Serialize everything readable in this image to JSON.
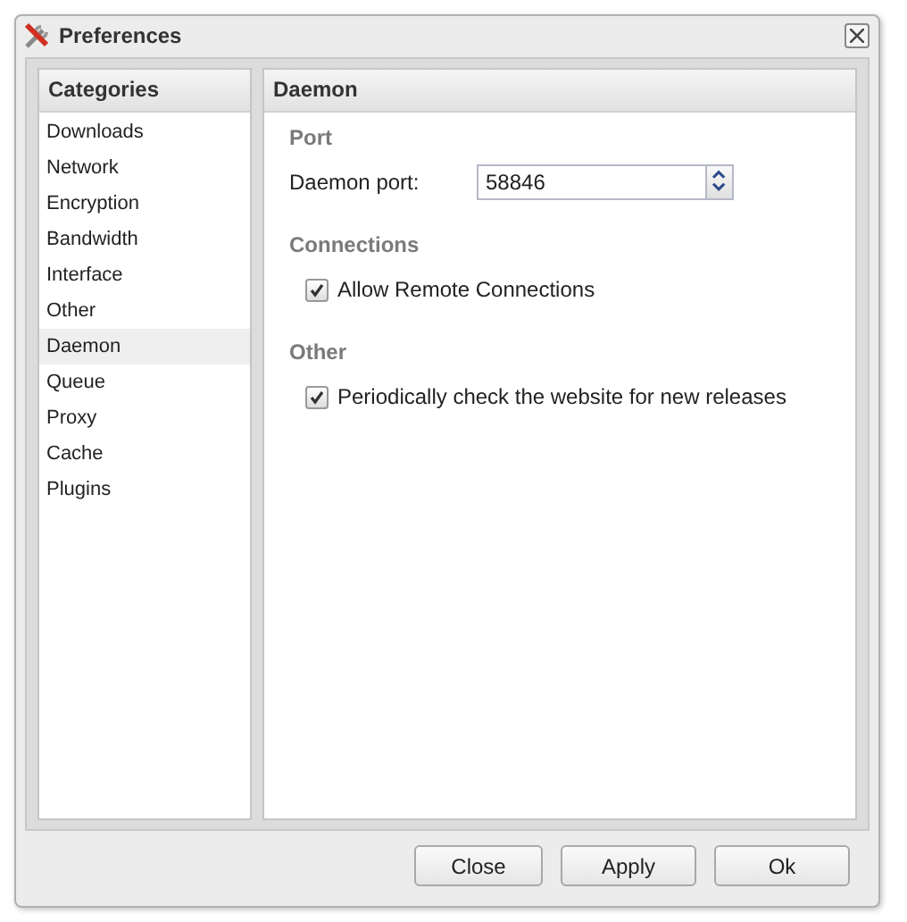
{
  "window": {
    "title": "Preferences"
  },
  "categories": {
    "title": "Categories",
    "items": [
      {
        "label": "Downloads",
        "selected": false
      },
      {
        "label": "Network",
        "selected": false
      },
      {
        "label": "Encryption",
        "selected": false
      },
      {
        "label": "Bandwidth",
        "selected": false
      },
      {
        "label": "Interface",
        "selected": false
      },
      {
        "label": "Other",
        "selected": false
      },
      {
        "label": "Daemon",
        "selected": true
      },
      {
        "label": "Queue",
        "selected": false
      },
      {
        "label": "Proxy",
        "selected": false
      },
      {
        "label": "Cache",
        "selected": false
      },
      {
        "label": "Plugins",
        "selected": false
      }
    ]
  },
  "panel": {
    "title": "Daemon",
    "sections": [
      {
        "title": "Port",
        "fields": [
          {
            "kind": "spinner",
            "label": "Daemon port:",
            "value": "58846"
          }
        ]
      },
      {
        "title": "Connections",
        "fields": [
          {
            "kind": "checkbox",
            "label": "Allow Remote Connections",
            "checked": true
          }
        ]
      },
      {
        "title": "Other",
        "fields": [
          {
            "kind": "checkbox",
            "label": "Periodically check the website for new releases",
            "checked": true
          }
        ]
      }
    ]
  },
  "buttons": [
    "Close",
    "Apply",
    "Ok"
  ]
}
